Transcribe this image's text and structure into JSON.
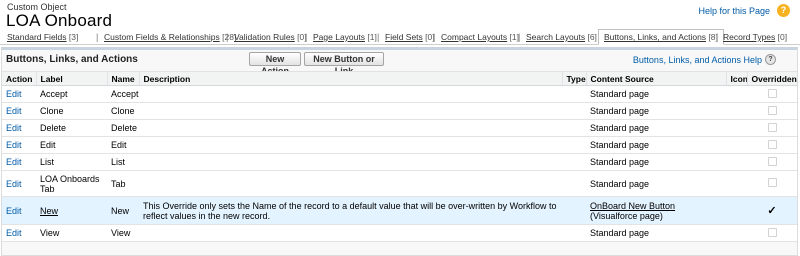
{
  "header": {
    "object_type": "Custom Object",
    "object_name": "LOA Onboard",
    "help_link": "Help for this Page",
    "help_icon": "help-icon"
  },
  "nav": [
    {
      "label": "Standard Fields",
      "count": "[3]"
    },
    {
      "label": "Custom Fields & Relationships",
      "count": "[28]"
    },
    {
      "label": "Validation Rules",
      "count": "[0]"
    },
    {
      "label": "Page Layouts",
      "count": "[1]"
    },
    {
      "label": "Field Sets",
      "count": "[0]"
    },
    {
      "label": "Compact Layouts",
      "count": "[1]"
    },
    {
      "label": "Search Layouts",
      "count": "[6]"
    },
    {
      "label": "Buttons, Links, and Actions",
      "count": "[8]"
    },
    {
      "label": "Record Types",
      "count": "[0]"
    }
  ],
  "nav_separator": "|",
  "panel": {
    "title": "Buttons, Links, and Actions",
    "new_action_button": "New Action",
    "new_button_link_button": "New Button or Link",
    "help_link": "Buttons, Links, and Actions Help",
    "help_icon_glyph": "?"
  },
  "table": {
    "columns": [
      "Action",
      "Label",
      "Name",
      "Description",
      "Type",
      "Content Source",
      "Icon",
      "Overridden"
    ],
    "rows": [
      {
        "action": "Edit",
        "label": "Accept",
        "name": "Accept",
        "description": "",
        "type": "",
        "content_source": "Standard page",
        "icon": "",
        "overridden": false
      },
      {
        "action": "Edit",
        "label": "Clone",
        "name": "Clone",
        "description": "",
        "type": "",
        "content_source": "Standard page",
        "icon": "",
        "overridden": false
      },
      {
        "action": "Edit",
        "label": "Delete",
        "name": "Delete",
        "description": "",
        "type": "",
        "content_source": "Standard page",
        "icon": "",
        "overridden": false
      },
      {
        "action": "Edit",
        "label": "Edit",
        "name": "Edit",
        "description": "",
        "type": "",
        "content_source": "Standard page",
        "icon": "",
        "overridden": false
      },
      {
        "action": "Edit",
        "label": "List",
        "name": "List",
        "description": "",
        "type": "",
        "content_source": "Standard page",
        "icon": "",
        "overridden": false
      },
      {
        "action": "Edit",
        "label": "LOA Onboards Tab",
        "name": "Tab",
        "description": "",
        "type": "",
        "content_source": "Standard page",
        "icon": "",
        "overridden": false
      },
      {
        "action": "Edit",
        "label": "New",
        "name": "New",
        "description": "This Override only sets the Name of the record to a default value that will be over-written by Workflow to reflect values in the new record.",
        "type": "",
        "content_source_link": "OnBoard New Button",
        "content_source": " (Visualforce page)",
        "icon": "",
        "overridden": true,
        "highlight": true
      },
      {
        "action": "Edit",
        "label": "View",
        "name": "View",
        "description": "",
        "type": "",
        "content_source": "Standard page",
        "icon": "",
        "overridden": false
      }
    ],
    "check_glyph": "✓"
  },
  "colors": {
    "link": "#015ba7",
    "highlight_row": "#e3f3ff",
    "help_icon": "#f6b221",
    "panel_border_top": "#c8d5e0"
  }
}
